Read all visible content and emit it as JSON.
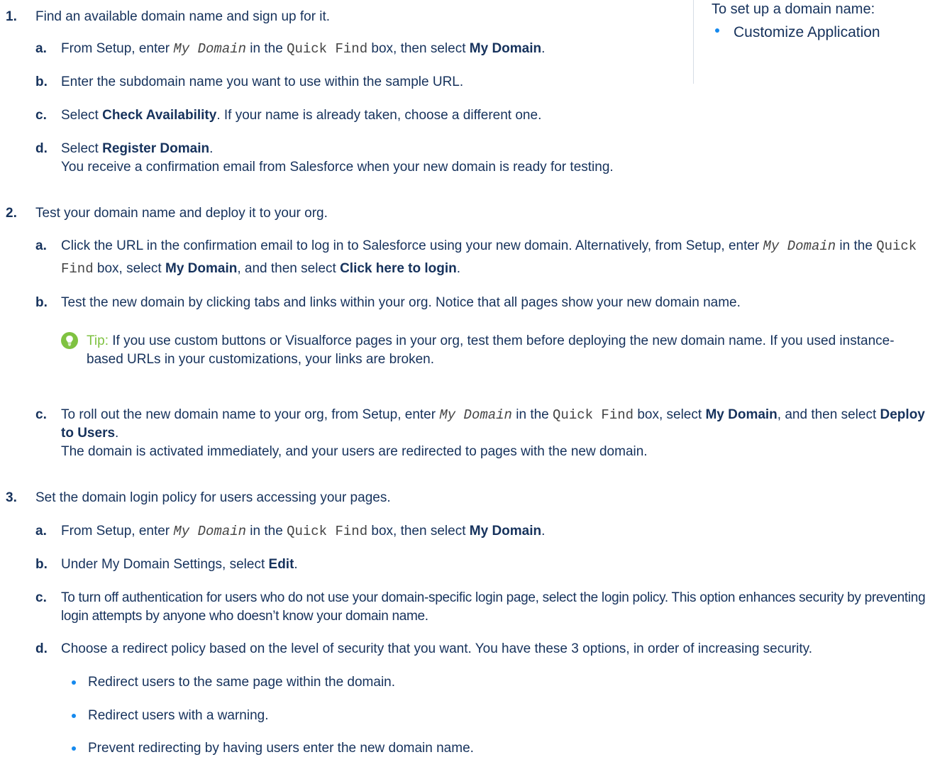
{
  "sidebar": {
    "title": "To set up a domain name:",
    "item": "Customize Application"
  },
  "steps": [
    {
      "num": "1.",
      "text": "Find an available domain name and sign up for it.",
      "subs": [
        {
          "letter": "a.",
          "pre": "From Setup, enter ",
          "code1": "My Domain",
          "mid1": " in the ",
          "code2": "Quick Find",
          "mid2": " box, then select ",
          "bold1": "My Domain",
          "post": "."
        },
        {
          "letter": "b.",
          "text": "Enter the subdomain name you want to use within the sample URL."
        },
        {
          "letter": "c.",
          "pre": "Select ",
          "bold1": "Check Availability",
          "post": ". If your name is already taken, choose a different one."
        },
        {
          "letter": "d.",
          "pre": "Select ",
          "bold1": "Register Domain",
          "post": ".",
          "line2": "You receive a confirmation email from Salesforce when your new domain is ready for testing."
        }
      ]
    },
    {
      "num": "2.",
      "text": "Test your domain name and deploy it to your org.",
      "subs": [
        {
          "letter": "a.",
          "pre": "Click the URL in the confirmation email to log in to Salesforce using your new domain. Alternatively, from Setup, enter ",
          "code1": "My Domain",
          "mid1": " in the ",
          "code2": "Quick Find",
          "mid2": " box, select ",
          "bold1": "My Domain",
          "mid3": ", and then select ",
          "bold2": "Click here to login",
          "post": "."
        },
        {
          "letter": "b.",
          "text": "Test the new domain by clicking tabs and links within your org. Notice that all pages show your new domain name."
        },
        {
          "letter": "c.",
          "pre": "To roll out the new domain name to your org, from Setup, enter ",
          "code1": "My Domain",
          "mid1": " in the ",
          "code2": "Quick Find",
          "mid2": " box, select ",
          "bold1": "My Domain",
          "mid3": ", and then select ",
          "bold2": "Deploy to Users",
          "post": ".",
          "line2": "The domain is activated immediately, and your users are redirected to pages with the new domain."
        }
      ],
      "tip": {
        "label": "Tip:",
        "text": " If you use custom buttons or Visualforce pages in your org, test them before deploying the new domain name. If you used instance-based URLs in your customizations, your links are broken."
      }
    },
    {
      "num": "3.",
      "text": "Set the domain login policy for users accessing your pages.",
      "subs": [
        {
          "letter": "a.",
          "pre": "From Setup, enter ",
          "code1": "My Domain",
          "mid1": " in the ",
          "code2": "Quick Find",
          "mid2": " box, then select ",
          "bold1": "My Domain",
          "post": "."
        },
        {
          "letter": "b.",
          "pre": "Under My Domain Settings, select ",
          "bold1": "Edit",
          "post": "."
        },
        {
          "letter": "c.",
          "text": "To turn off authentication for users who do not use your domain-specific login page, select the login policy. This option enhances security by preventing login attempts by anyone who doesn’t know your domain name."
        },
        {
          "letter": "d.",
          "text": "Choose a redirect policy based on the level of security that you want. You have these 3 options, in order of increasing security."
        }
      ],
      "bullets": [
        "Redirect users to the same page within the domain.",
        "Redirect users with a warning.",
        "Prevent redirecting by having users enter the new domain name."
      ]
    }
  ],
  "colors": {
    "text": "#16325c",
    "accent_blue": "#1589ee",
    "tip_green": "#7fc241"
  },
  "icons": {
    "tip": "lightbulb-icon",
    "bullet": "bullet-dot-icon"
  }
}
